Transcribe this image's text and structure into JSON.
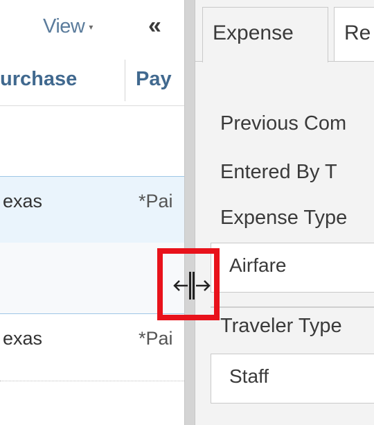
{
  "left_pane": {
    "view_label": "View",
    "view_caret": "▾",
    "collapse_glyph": "«",
    "columns": [
      "urchase",
      "Pay"
    ],
    "rows": [
      {
        "col1": "exas",
        "col2": "*Pai"
      },
      {
        "col1": "exas",
        "col2": "*Pai"
      }
    ]
  },
  "splitter": {
    "cursor_icon": "resize-horizontal-icon",
    "highlight_color": "#e8121b"
  },
  "right_pane": {
    "tabs": [
      {
        "label": "Expense",
        "active": true
      },
      {
        "label": "Re",
        "active": false
      }
    ],
    "fields": {
      "previous_comments_label": "Previous Com",
      "entered_by_label": "Entered By T",
      "expense_type_label": "Expense Type",
      "expense_type_value": "Airfare",
      "traveler_type_label": "Traveler Type",
      "traveler_type_value": "Staff"
    }
  },
  "colors": {
    "link_blue": "#5b7c9c",
    "header_blue": "#41698f",
    "selected_row_bg": "#eaf4fc",
    "splitter_gray": "#d4d4d4",
    "right_pane_bg": "#f3f3f3"
  }
}
